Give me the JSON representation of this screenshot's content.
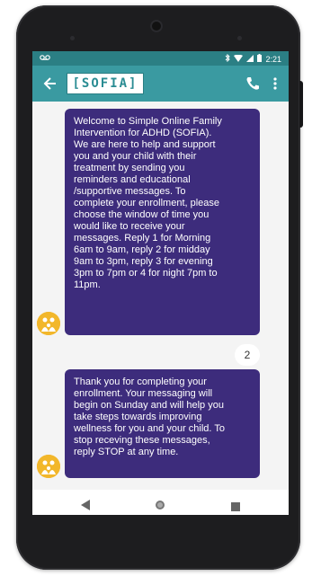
{
  "status_bar": {
    "left_icon": "voicemail-icon",
    "right_icons": [
      "bluetooth-icon",
      "wifi-icon",
      "signal-icon",
      "battery-icon"
    ],
    "time": "2:21"
  },
  "app_bar": {
    "logo_text": "[SOFIA]",
    "back_icon": "arrow-left-icon",
    "call_icon": "phone-icon",
    "menu_icon": "more-vertical-icon"
  },
  "messages": [
    {
      "sender": "SOFIA",
      "text": "Welcome to Simple Online Family\nIntervention for ADHD (SOFIA).\nWe are here to help and support\nyou and your child with their\ntreatment by sending you\nreminders and educational\n/supportive messages. To\ncomplete your enrollment, please\nchoose the window of time you\nwould like to receive your\nmessages. Reply 1 for Morning\n6am to 9am, reply 2 for midday\n9am to 3pm, reply 3 for evening\n3pm to 7pm or 4 for night 7pm to\n11pm."
    },
    {
      "sender": "user",
      "text": "2"
    },
    {
      "sender": "SOFIA",
      "text": "Thank you for completing your\nenrollment. Your messaging will\nbegin on Sunday and will help you\ntake steps towards improving\nwellness for you and your child. To\nstop receving these messages,\nreply STOP at any time."
    }
  ],
  "colors": {
    "status_bar": "#2b7f84",
    "app_bar": "#3a9aa1",
    "bubble": "#3d2c7c",
    "avatar": "#f2b72b",
    "chat_background": "#f4f4f4"
  },
  "nav_bar": {
    "back_icon": "nav-back-icon",
    "home_icon": "nav-home-icon",
    "recents_icon": "nav-recents-icon"
  }
}
